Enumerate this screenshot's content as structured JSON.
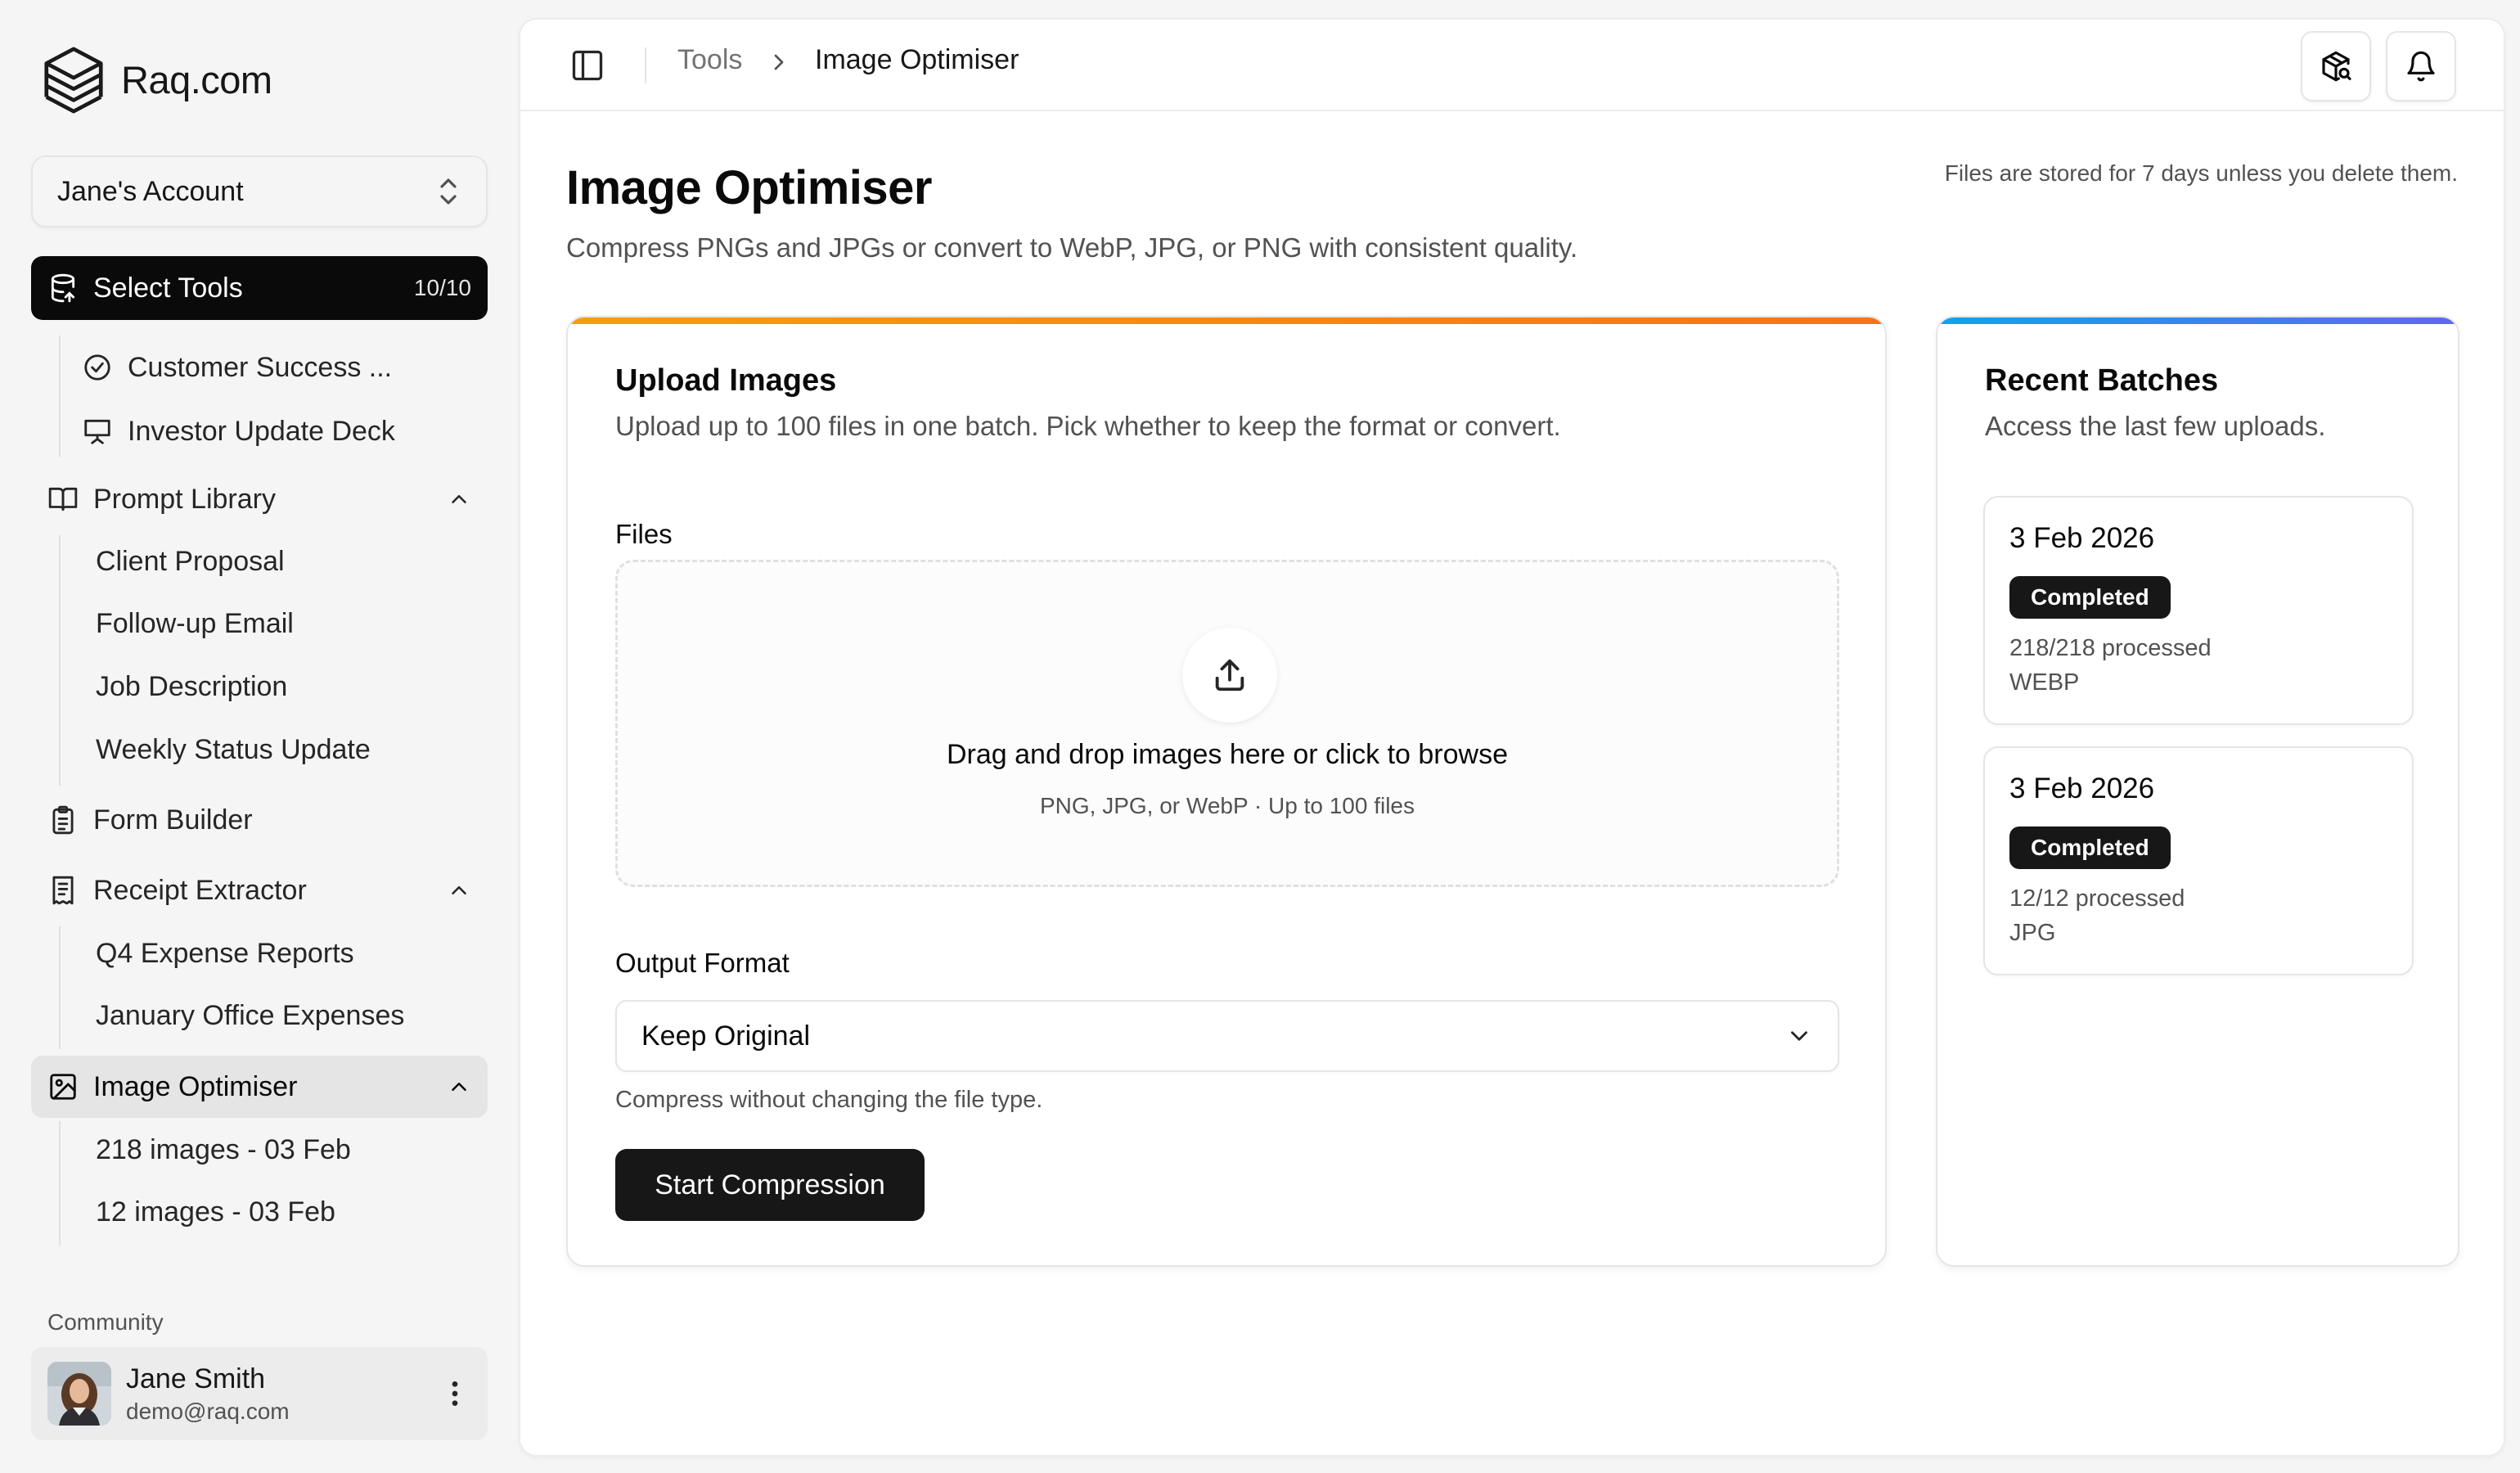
{
  "brand": {
    "name": "Raq.com"
  },
  "account": {
    "label": "Jane's Account"
  },
  "nav": {
    "select_tools": {
      "label": "Select Tools",
      "count": "10/10"
    },
    "select_tools_children": [
      "Customer Success ...",
      "Investor Update Deck"
    ],
    "prompt_library": {
      "label": "Prompt Library",
      "children": [
        "Client Proposal",
        "Follow-up Email",
        "Job Description",
        "Weekly Status Update"
      ]
    },
    "form_builder": {
      "label": "Form Builder"
    },
    "receipt_extractor": {
      "label": "Receipt Extractor",
      "children": [
        "Q4 Expense Reports",
        "January Office Expenses"
      ]
    },
    "image_optimiser": {
      "label": "Image Optimiser",
      "children": [
        "218 images - 03 Feb",
        "12 images - 03 Feb"
      ]
    },
    "section_community": "Community"
  },
  "user": {
    "name": "Jane Smith",
    "email": "demo@raq.com"
  },
  "breadcrumb": {
    "parent": "Tools",
    "current": "Image Optimiser"
  },
  "page": {
    "title": "Image Optimiser",
    "subtitle": "Compress PNGs and JPGs or convert to WebP, JPG, or PNG with consistent quality.",
    "note": "Files are stored for 7 days unless you delete them."
  },
  "upload": {
    "title": "Upload Images",
    "subtitle": "Upload up to 100 files in one batch. Pick whether to keep the format or convert.",
    "files_label": "Files",
    "dropzone_title": "Drag and drop images here or click to browse",
    "dropzone_hint": "PNG, JPG, or WebP · Up to 100 files",
    "output_label": "Output Format",
    "output_value": "Keep Original",
    "output_helper": "Compress without changing the file type.",
    "start_button": "Start Compression"
  },
  "batches": {
    "title": "Recent Batches",
    "subtitle": "Access the last few uploads.",
    "items": [
      {
        "date": "3 Feb 2026",
        "status": "Completed",
        "processed": "218/218 processed",
        "format": "WEBP"
      },
      {
        "date": "3 Feb 2026",
        "status": "Completed",
        "processed": "12/12 processed",
        "format": "JPG"
      }
    ]
  },
  "colors": {
    "upload_accent": [
      "#f59e0b",
      "#f97316"
    ],
    "batches_accent": [
      "#0ea5e9",
      "#6366f1"
    ],
    "primary": "#171717"
  }
}
